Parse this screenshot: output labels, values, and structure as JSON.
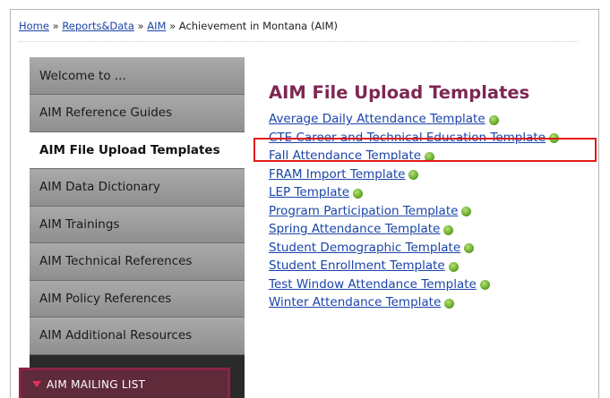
{
  "breadcrumb": {
    "home": "Home",
    "sep1": "»",
    "reports": "Reports&Data",
    "sep2": "»",
    "aim": "AIM",
    "sep3": "»",
    "current": "Achievement in Montana (AIM)"
  },
  "sidebar": {
    "items": [
      {
        "label": "Welcome to ..."
      },
      {
        "label": "AIM Reference Guides"
      },
      {
        "label": "AIM File Upload Templates",
        "active": true
      },
      {
        "label": "AIM Data Dictionary"
      },
      {
        "label": "AIM Trainings"
      },
      {
        "label": "AIM Technical References"
      },
      {
        "label": "AIM Policy References"
      },
      {
        "label": "AIM Additional Resources"
      }
    ],
    "mailing_label": "AIM MAILING LIST"
  },
  "main": {
    "title": "AIM File Upload Templates",
    "links": [
      {
        "label": "Average Daily Attendance Template"
      },
      {
        "label": "CTE Career and Technical Education Template"
      },
      {
        "label": "Fall Attendance Template"
      },
      {
        "label": "FRAM Import Template"
      },
      {
        "label": "LEP Template"
      },
      {
        "label": "Program Participation Template"
      },
      {
        "label": "Spring Attendance Template"
      },
      {
        "label": "Student Demographic Template"
      },
      {
        "label": "Student Enrollment Template"
      },
      {
        "label": "Test Window Attendance Template"
      },
      {
        "label": "Winter Attendance Template"
      }
    ],
    "link_icon": "external-link-icon"
  },
  "colors": {
    "link": "#1a44a8",
    "title": "#7d2752",
    "highlight": "#e01a1a",
    "mailing_bg": "#5f2a3a"
  }
}
